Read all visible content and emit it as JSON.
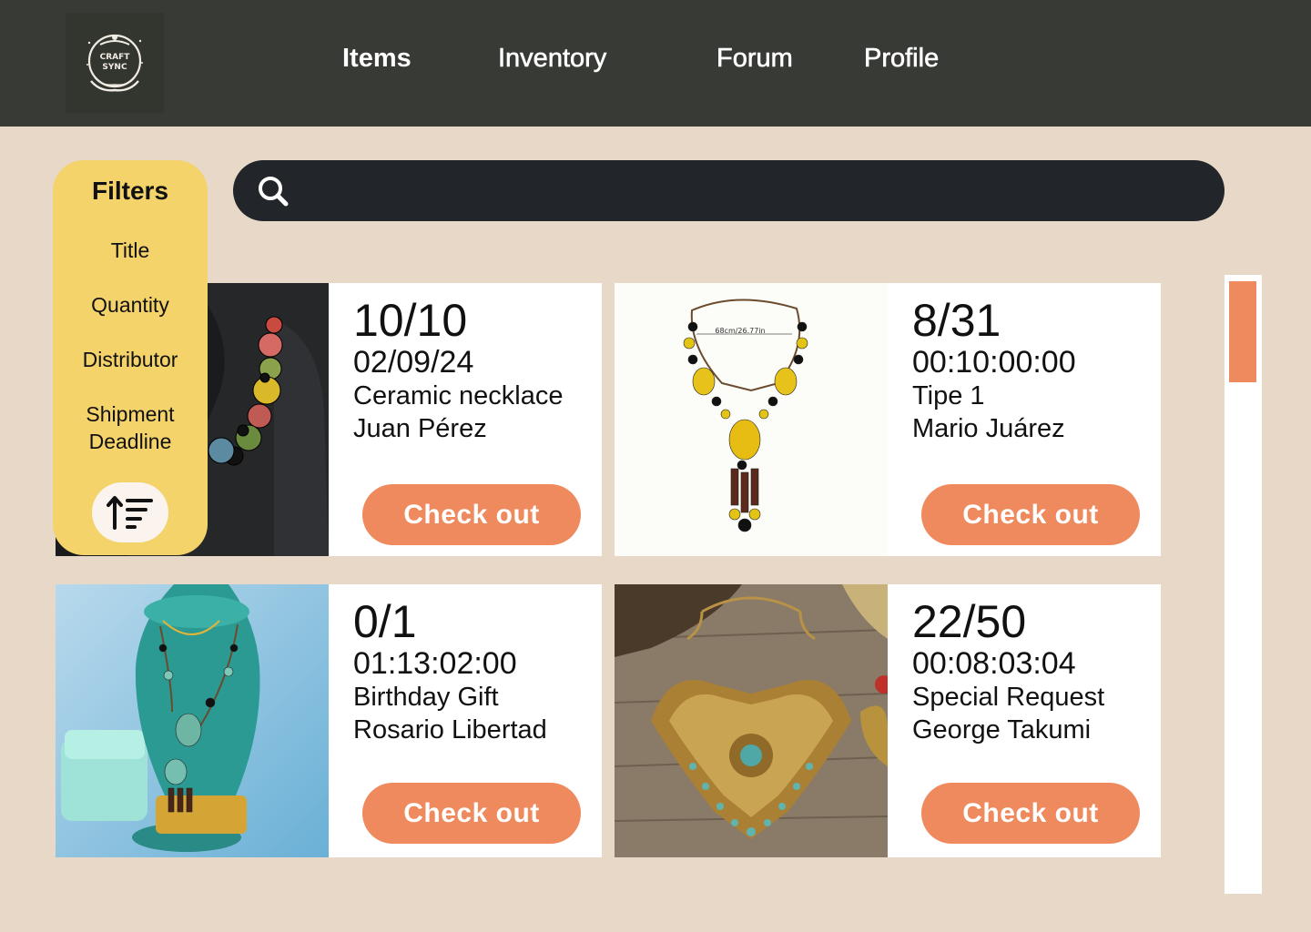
{
  "header": {
    "logo_text_top": "CRAFT",
    "logo_text_bottom": "SYNC",
    "nav": [
      "Items",
      "Inventory",
      "Forum",
      "Profile"
    ]
  },
  "search": {
    "placeholder": "",
    "value": ""
  },
  "filters": {
    "title": "Filters",
    "options": [
      "Title",
      "Quantity",
      "Distributor",
      "Shipment Deadline"
    ],
    "sort_icon": "sort-ascending-icon"
  },
  "cards": [
    {
      "quantity": "10/10",
      "time": "02/09/24",
      "title": "Ceramic necklace",
      "distributor": "Juan Pérez",
      "button": "Check out"
    },
    {
      "quantity": "8/31",
      "time": "00:10:00:00",
      "title": "Tipe 1",
      "distributor": "Mario Juárez",
      "button": "Check out",
      "image_label": "68cm/26.77in"
    },
    {
      "quantity": "0/1",
      "time": "01:13:02:00",
      "title": "Birthday Gift",
      "distributor": "Rosario Libertad",
      "button": "Check out"
    },
    {
      "quantity": "22/50",
      "time": "00:08:03:04",
      "title": "Special Request",
      "distributor": "George Takumi",
      "button": "Check out"
    }
  ],
  "colors": {
    "header_bg": "#383a35",
    "page_bg": "#e7d8c7",
    "accent": "#ee8a5d",
    "filters_bg": "#f4d36a",
    "search_bg": "#22252a"
  }
}
